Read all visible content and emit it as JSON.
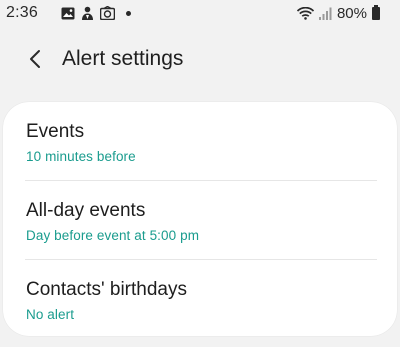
{
  "status_bar": {
    "time": "2:36",
    "battery_percent": "80%",
    "left_icons": [
      "image-icon",
      "person-notification-icon",
      "email-icon",
      "more-dot-icon"
    ],
    "right_icons": [
      "wifi-icon",
      "signal-icon",
      "battery-icon"
    ]
  },
  "header": {
    "title": "Alert settings",
    "back_icon": "chevron-left-icon"
  },
  "settings": [
    {
      "title": "Events",
      "value": "10 minutes before"
    },
    {
      "title": "All-day events",
      "value": "Day before event at 5:00 pm"
    },
    {
      "title": "Contacts' birthdays",
      "value": "No alert"
    }
  ],
  "colors": {
    "accent": "#1a9c8e",
    "background": "#f2f2f2",
    "card": "#ffffff"
  }
}
